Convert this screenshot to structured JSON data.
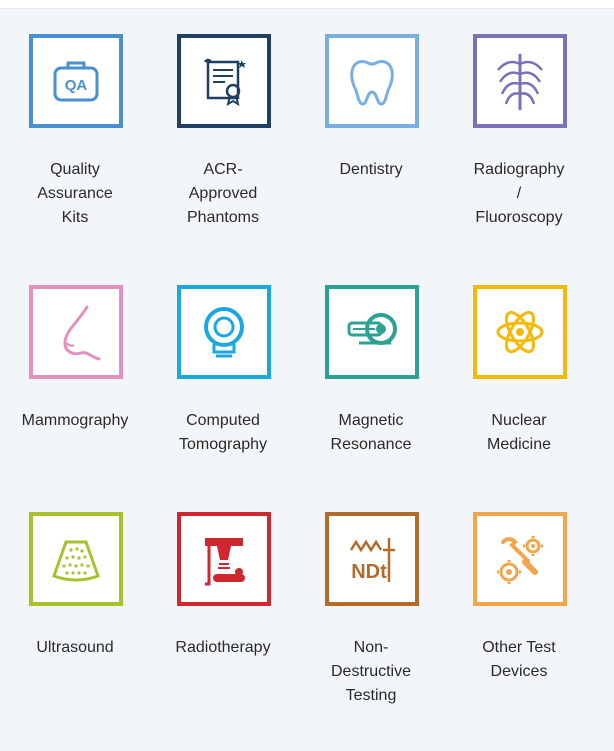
{
  "categories": [
    {
      "label": "Quality\nAssurance\nKits",
      "color": "#4a8fd0",
      "icon": "qa-kit-icon"
    },
    {
      "label": "ACR-\nApproved\nPhantoms",
      "color": "#1f3f63",
      "icon": "certificate-icon"
    },
    {
      "label": "Dentistry",
      "color": "#78aee0",
      "icon": "tooth-icon"
    },
    {
      "label": "Radiography\n/\nFluoroscopy",
      "color": "#7a72b8",
      "icon": "ribcage-icon"
    },
    {
      "label": "Mammography",
      "color": "#e48fc0",
      "icon": "breast-profile-icon"
    },
    {
      "label": "Computed\nTomography",
      "color": "#1ba7df",
      "icon": "ct-scanner-icon"
    },
    {
      "label": "Magnetic\nResonance",
      "color": "#2aa394",
      "icon": "mri-scanner-icon"
    },
    {
      "label": "Nuclear\nMedicine",
      "color": "#f4b90a",
      "icon": "atom-icon"
    },
    {
      "label": "Ultrasound",
      "color": "#a6c22c",
      "icon": "ultrasound-scan-icon"
    },
    {
      "label": "Radiotherapy",
      "color": "#d0262e",
      "icon": "linac-icon"
    },
    {
      "label": "Non-\nDestructive\nTesting",
      "color": "#b36b2c",
      "icon": "ndt-icon"
    },
    {
      "label": "Other Test\nDevices",
      "color": "#f3a54a",
      "icon": "tools-gears-icon"
    }
  ]
}
